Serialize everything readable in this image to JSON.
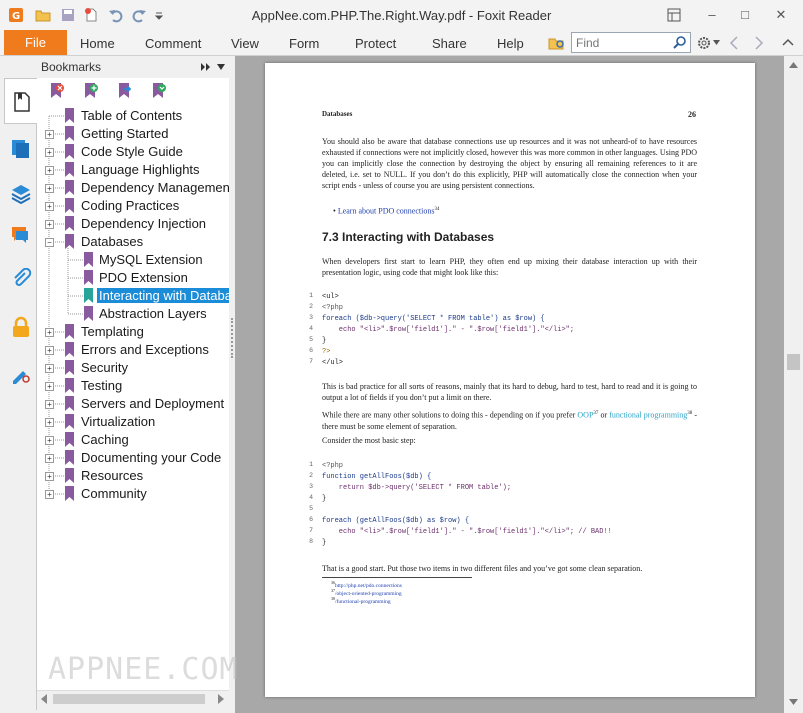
{
  "window": {
    "title": "AppNee.com.PHP.The.Right.Way.pdf - Foxit Reader"
  },
  "ribbon": {
    "file": "File",
    "tabs": [
      "Home",
      "Comment",
      "View",
      "Form",
      "Protect",
      "Share",
      "Help"
    ],
    "find_placeholder": "Find"
  },
  "bookmarks": {
    "header": "Bookmarks",
    "items": [
      {
        "label": "Table of Contents"
      },
      {
        "label": "Getting Started"
      },
      {
        "label": "Code Style Guide"
      },
      {
        "label": "Language Highlights"
      },
      {
        "label": "Dependency Management"
      },
      {
        "label": "Coding Practices"
      },
      {
        "label": "Dependency Injection"
      },
      {
        "label": "Databases"
      },
      {
        "label": "MySQL Extension"
      },
      {
        "label": "PDO Extension"
      },
      {
        "label": "Interacting with Databa"
      },
      {
        "label": "Abstraction Layers"
      },
      {
        "label": "Templating"
      },
      {
        "label": "Errors and Exceptions"
      },
      {
        "label": "Security"
      },
      {
        "label": "Testing"
      },
      {
        "label": "Servers and Deployment"
      },
      {
        "label": "Virtualization"
      },
      {
        "label": "Caching"
      },
      {
        "label": "Documenting your Code"
      },
      {
        "label": "Resources"
      },
      {
        "label": "Community"
      }
    ]
  },
  "page": {
    "header_left": "Databases",
    "page_number": "26",
    "p1": "You should also be aware that database connections use up resources and it was not unheard-of to have resources exhausted if connections were not implicitly closed, however this was more common in other languages. Using PDO you can implicitly close the connection by destroying the object by ensuring all remaining references to it are deleted, i.e. set to NULL. If you don’t do this explicitly, PHP will automatically close the connection when your script ends - unless of course you are using persistent connections.",
    "bullet": "Learn about PDO connections",
    "bullet_sup": "34",
    "heading": "7.3 Interacting with Databases",
    "p2": "When developers first start to learn PHP, they often end up mixing their database interaction up with their presentation logic, using code that might look like this:",
    "code1": [
      {
        "n": "1",
        "t": "<ul>"
      },
      {
        "n": "2",
        "t": "<?php"
      },
      {
        "n": "3",
        "t": "foreach ($db->query('SELECT * FROM table') as $row) {"
      },
      {
        "n": "4",
        "t": "    echo \"<li>\".$row['field1'].\" - \".$row['field1'].\"</li>\";"
      },
      {
        "n": "5",
        "t": "}"
      },
      {
        "n": "6",
        "t": "?>"
      },
      {
        "n": "7",
        "t": "</ul>"
      }
    ],
    "p3": "This is bad practice for all sorts of reasons, mainly that its hard to debug, hard to test, hard to read and it is going to output a lot of fields if you don’t put a limit on there.",
    "p4a": "While there are many other solutions to doing this - depending on if you prefer ",
    "p4_oop": "OOP",
    "p4_oop_sup": "37",
    "p4b": " or ",
    "p4_fp": "functional programming",
    "p4_fp_sup": "38",
    "p4c": " - there must be some element of separation.",
    "p5": "Consider the most basic step:",
    "code2": [
      {
        "n": "1",
        "t": "<?php"
      },
      {
        "n": "2",
        "t": "function getAllFoos($db) {"
      },
      {
        "n": "3",
        "t": "    return $db->query('SELECT * FROM table');"
      },
      {
        "n": "4",
        "t": "}"
      },
      {
        "n": "5",
        "t": ""
      },
      {
        "n": "6",
        "t": "foreach (getAllFoos($db) as $row) {"
      },
      {
        "n": "7",
        "t": "    echo \"<li>\".$row['field1'].\" - \".$row['field1'].\"</li>\"; // BAD!!"
      },
      {
        "n": "8",
        "t": "}"
      }
    ],
    "p6": "That is a good start. Put those two items in two different files and you’ve got some clean separation.",
    "footnotes": [
      {
        "sup": "36",
        "text": "http://php.net/pdo.connections"
      },
      {
        "sup": "37",
        "text": "/object-oriented-programming"
      },
      {
        "sup": "38",
        "text": "/functional-programming"
      }
    ]
  },
  "watermark": "APPNEE.COM",
  "colors": {
    "accent": "#f07b1c",
    "selection": "#1b8cd8",
    "bookmark": "#8a5a9e"
  }
}
